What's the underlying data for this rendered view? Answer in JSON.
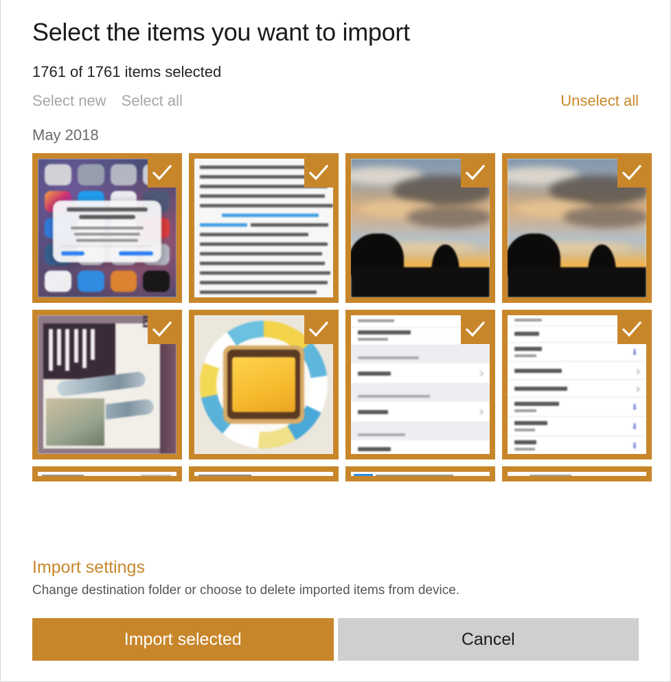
{
  "dialog": {
    "title": "Select the items you want to import",
    "count_status": "1761 of 1761 items selected",
    "actions": {
      "select_new": "Select new",
      "select_all": "Select all",
      "unselect_all": "Unselect all"
    },
    "groups": [
      {
        "date_label": "May 2018"
      }
    ],
    "thumbnails": [
      {
        "name": "ios-home-screen-photo-permission-dialog",
        "selected": true,
        "kind": "ios-home"
      },
      {
        "name": "article-text-screenshot-coffee",
        "selected": true,
        "kind": "doc"
      },
      {
        "name": "sunset-clouds-treeline-photo-1",
        "selected": true,
        "kind": "sunset"
      },
      {
        "name": "sunset-clouds-treeline-photo-2",
        "selected": true,
        "kind": "sunset"
      },
      {
        "name": "product-package-gas-cartridges-photo",
        "selected": true,
        "kind": "product"
      },
      {
        "name": "cheese-toast-on-patterned-plate-photo",
        "selected": true,
        "kind": "food"
      },
      {
        "name": "ios-settings-list-screenshot-1",
        "selected": true,
        "kind": "list-a"
      },
      {
        "name": "ios-settings-voices-list-screenshot",
        "selected": true,
        "kind": "list-b"
      },
      {
        "name": "partial-thumbnail-row3-1",
        "selected": true,
        "kind": "partial"
      },
      {
        "name": "partial-thumbnail-row3-2",
        "selected": true,
        "kind": "partial"
      },
      {
        "name": "partial-thumbnail-row3-3",
        "selected": true,
        "kind": "partial"
      },
      {
        "name": "partial-thumbnail-row3-4",
        "selected": true,
        "kind": "partial"
      }
    ],
    "footer": {
      "settings_link": "Import settings",
      "settings_description": "Change destination folder or choose to delete imported items from device.",
      "primary_button": "Import selected",
      "secondary_button": "Cancel"
    },
    "colors": {
      "accent": "#c8862a",
      "accent_text": "#c8862a",
      "disabled_text": "#a6a6a6",
      "secondary_button": "#cfcfcf",
      "title_text": "#1a1a1a",
      "group_date_text": "#6b6b6b"
    },
    "icons": {
      "checkmark": "check-icon"
    }
  }
}
